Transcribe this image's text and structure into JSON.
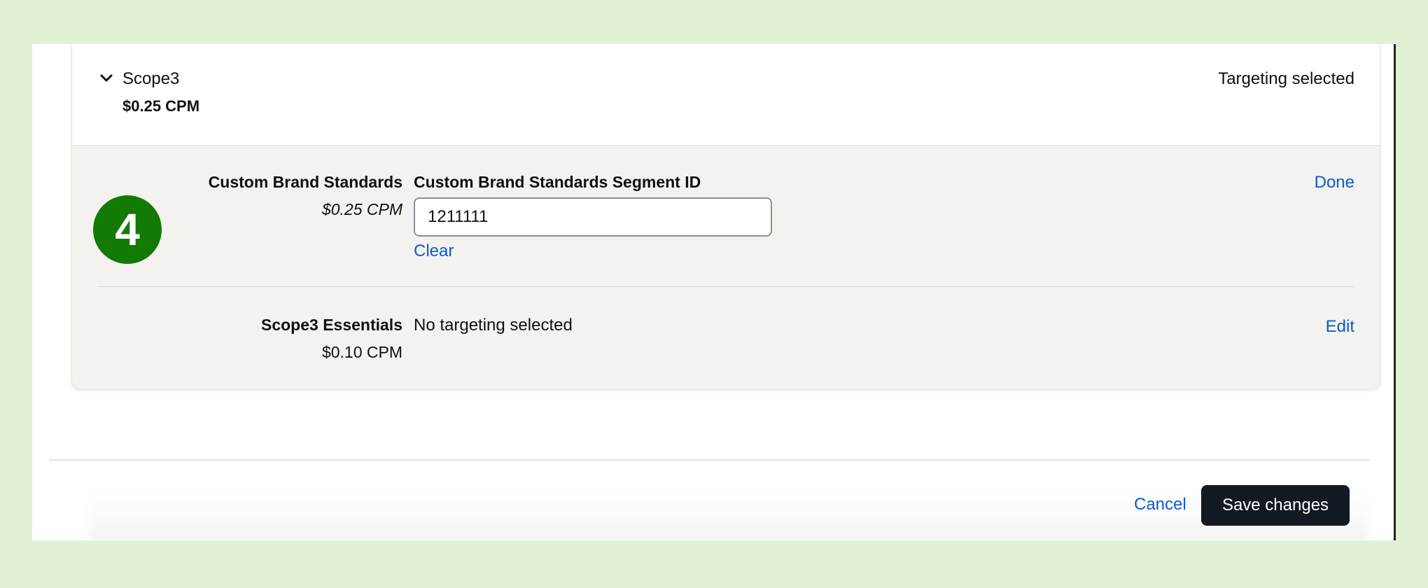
{
  "provider": {
    "name": "Scope3",
    "price": "$0.25 CPM",
    "status": "Targeting selected",
    "expand_icon": "chevron-down-icon"
  },
  "step_badge": "4",
  "segments": [
    {
      "name": "Custom Brand Standards",
      "price": "$0.25 CPM",
      "field_label": "Custom Brand Standards Segment ID",
      "input_value": "1211111",
      "clear_label": "Clear",
      "action_label": "Done"
    },
    {
      "name": "Scope3 Essentials",
      "price": "$0.10 CPM",
      "status": "No targeting selected",
      "action_label": "Edit"
    }
  ],
  "footer": {
    "cancel_label": "Cancel",
    "save_label": "Save changes"
  },
  "colors": {
    "background": "#e1f2d4",
    "badge": "#127a05",
    "link": "#0b5bd3",
    "primary_button": "#131921",
    "body_panel": "#f3f2ef"
  }
}
